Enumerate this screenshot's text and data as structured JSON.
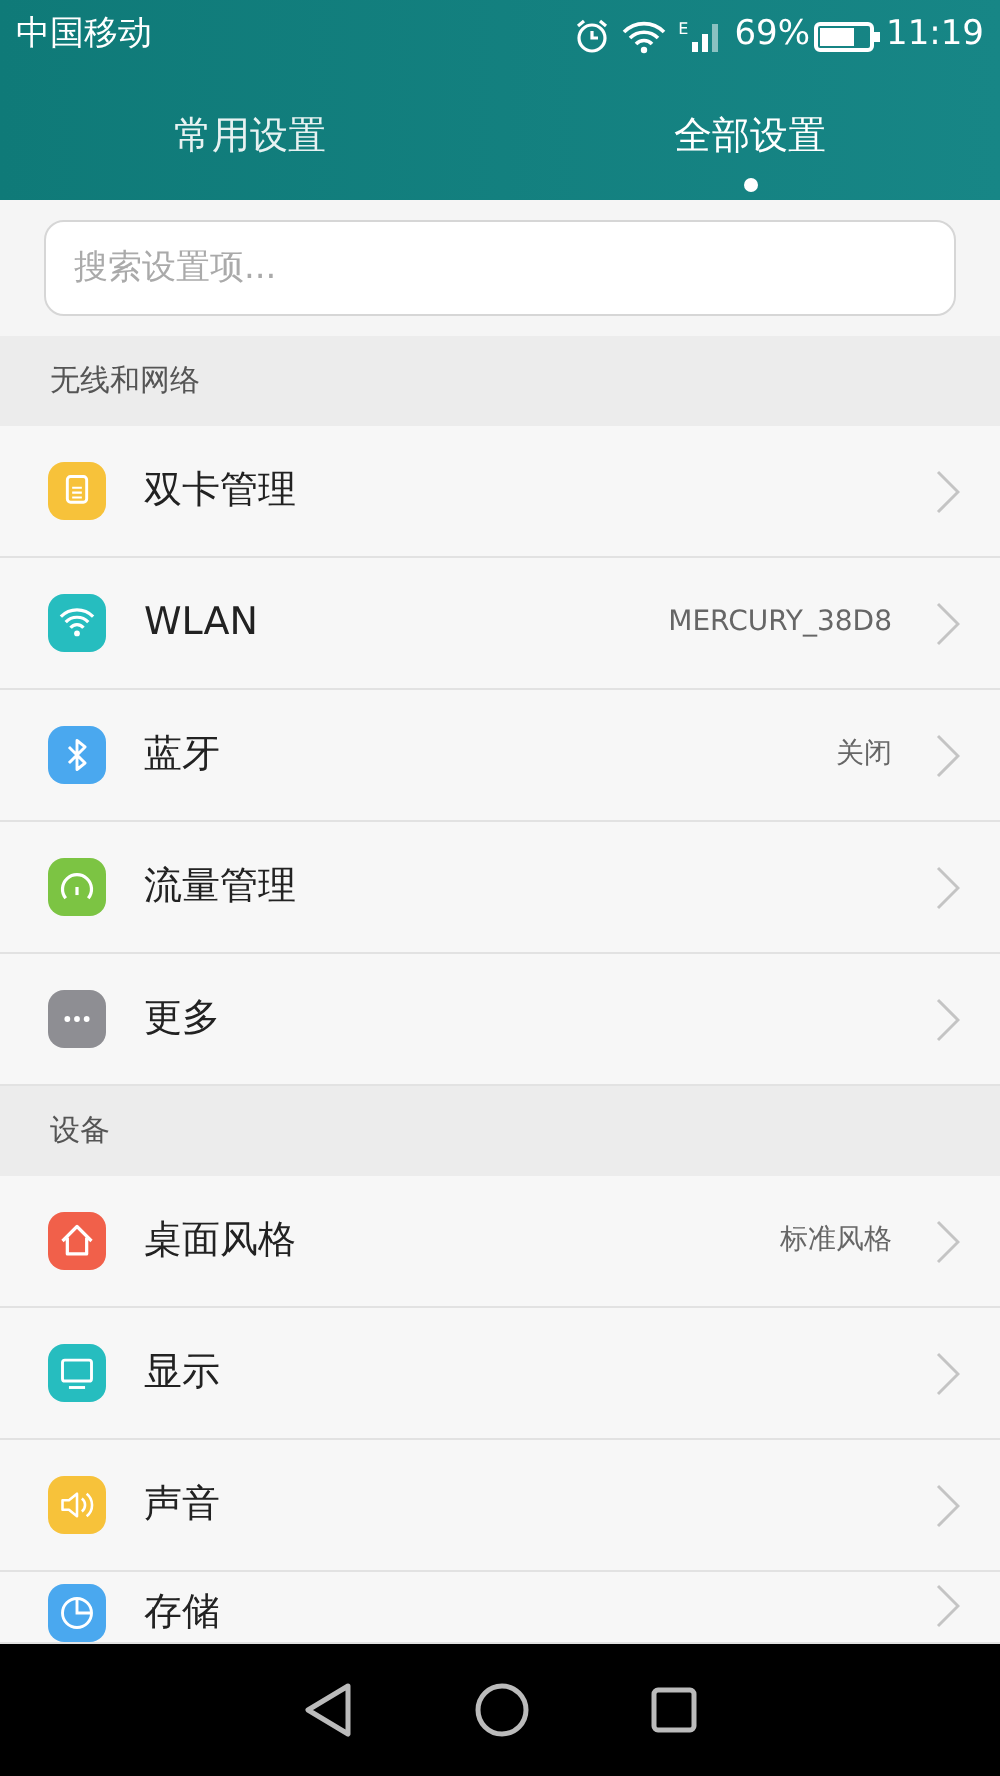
{
  "status_bar": {
    "carrier": "中国移动",
    "network": "E",
    "battery_text": "69%",
    "battery": {
      "level": 0.69
    },
    "time": "11:19"
  },
  "tabs": [
    {
      "label": "常用设置",
      "selected": false
    },
    {
      "label": "全部设置",
      "selected": true
    }
  ],
  "search": {
    "placeholder": "搜索设置项..."
  },
  "sections": [
    {
      "title": "无线和网络",
      "items": [
        {
          "label": "双卡管理",
          "kind": "sim",
          "color": "#f7c23a"
        },
        {
          "label": "WLAN",
          "value": "MERCURY_38D8",
          "kind": "wifi",
          "color": "#26bdbf"
        },
        {
          "label": "蓝牙",
          "value": "关闭",
          "kind": "bluetooth",
          "color": "#4aa8ef"
        },
        {
          "label": "流量管理",
          "kind": "gauge",
          "color": "#7cc443"
        },
        {
          "label": "更多",
          "kind": "more",
          "color": "#8e8e93"
        }
      ]
    },
    {
      "title": "设备",
      "items": [
        {
          "label": "桌面风格",
          "value": "标准风格",
          "kind": "home",
          "color": "#f1604a"
        },
        {
          "label": "显示",
          "kind": "display",
          "color": "#26bdbf"
        },
        {
          "label": "声音",
          "kind": "sound",
          "color": "#f7c23a"
        },
        {
          "label": "存储",
          "kind": "storage",
          "color": "#4aa8ef"
        }
      ]
    }
  ]
}
